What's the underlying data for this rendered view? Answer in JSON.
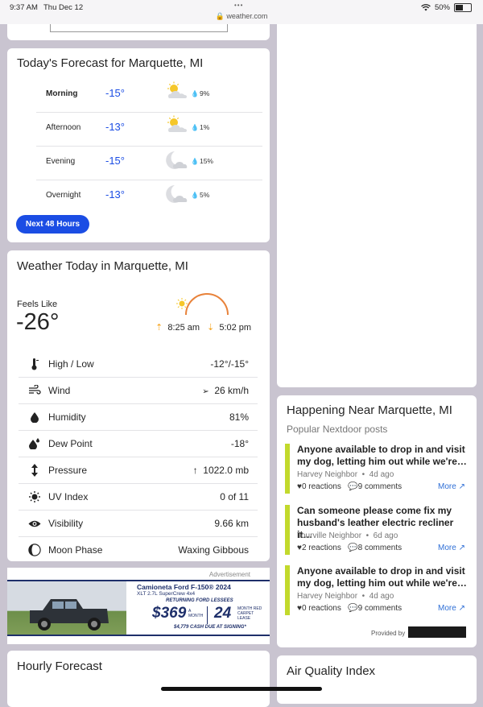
{
  "status_bar": {
    "time": "9:37 AM",
    "date": "Thu Dec 12",
    "url": "weather.com",
    "battery": "50%"
  },
  "todays_forecast": {
    "title": "Today's Forecast for Marquette, MI",
    "rows": [
      {
        "period": "Morning",
        "temp": "-15°",
        "precip": "9%",
        "icon": "partly-cloudy-day-icon"
      },
      {
        "period": "Afternoon",
        "temp": "-13°",
        "precip": "1%",
        "icon": "partly-cloudy-day-icon"
      },
      {
        "period": "Evening",
        "temp": "-15°",
        "precip": "15%",
        "icon": "partly-cloudy-night-icon"
      },
      {
        "period": "Overnight",
        "temp": "-13°",
        "precip": "5%",
        "icon": "partly-cloudy-night-icon"
      }
    ],
    "button": "Next 48 Hours"
  },
  "weather_today": {
    "title": "Weather Today in Marquette, MI",
    "feels_like_label": "Feels Like",
    "feels_like_value": "-26°",
    "sunrise": "8:25 am",
    "sunset": "5:02 pm",
    "details": [
      {
        "label": "High / Low",
        "value": "-12°/-15°",
        "icon": "thermometer-icon"
      },
      {
        "label": "Wind",
        "value": "26 km/h",
        "icon": "wind-icon"
      },
      {
        "label": "Humidity",
        "value": "81%",
        "icon": "humidity-drop-icon"
      },
      {
        "label": "Dew Point",
        "value": "-18°",
        "icon": "dew-point-icon"
      },
      {
        "label": "Pressure",
        "value": "1022.0 mb",
        "icon": "pressure-icon"
      },
      {
        "label": "UV Index",
        "value": "0 of 11",
        "icon": "uv-sun-icon"
      },
      {
        "label": "Visibility",
        "value": "9.66 km",
        "icon": "eye-icon"
      },
      {
        "label": "Moon Phase",
        "value": "Waxing Gibbous",
        "icon": "moon-phase-icon"
      }
    ]
  },
  "ad": {
    "label": "Advertisement",
    "headline": "Camioneta Ford F-150® 2024",
    "subline": "XLT 2.7L SuperCrew 4x4",
    "offer": "RETURNING FORD LESSEES",
    "price": "$369",
    "per": "A MONTH",
    "months": "24",
    "months_label": "MONTH RED CARPET LEASE",
    "cash": "$4,779 CASH DUE AT SIGNING*"
  },
  "hourly": {
    "title": "Hourly Forecast"
  },
  "nextdoor": {
    "title": "Happening Near Marquette, MI",
    "subtitle": "Popular Nextdoor posts",
    "posts": [
      {
        "text": "Anyone available to drop in and visit my dog, letting him out while we're…",
        "neighbor": "Harvey Neighbor",
        "age": "4d ago",
        "reactions": "0 reactions",
        "comments": "9 comments",
        "more": "More"
      },
      {
        "text": "Can someone please come fix my husband's leather electric recliner it…",
        "neighbor": "Tourville Neighbor",
        "age": "6d ago",
        "reactions": "2 reactions",
        "comments": "8 comments",
        "more": "More"
      },
      {
        "text": "Anyone available to drop in and visit my dog, letting him out while we're…",
        "neighbor": "Harvey Neighbor",
        "age": "4d ago",
        "reactions": "0 reactions",
        "comments": "9 comments",
        "more": "More"
      }
    ],
    "provided_by": "Provided by"
  },
  "air_quality": {
    "title": "Air Quality Index"
  },
  "colors": {
    "accent": "#1b4de4",
    "nextdoor_bar": "#c2d92c",
    "link": "#2f6fd6",
    "sun_arc": "#e8823a"
  }
}
